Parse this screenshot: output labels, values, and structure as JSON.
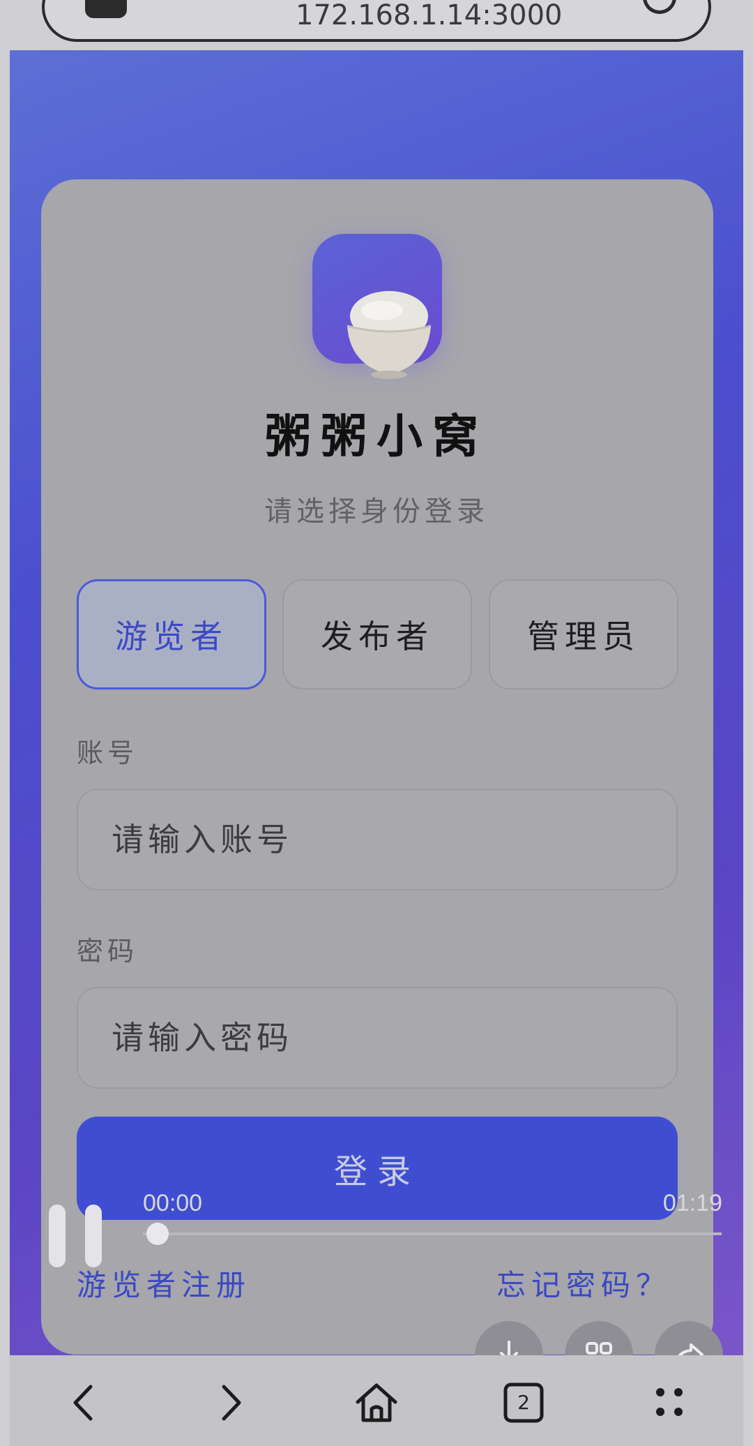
{
  "browser": {
    "address": "172.168.1.14:3000",
    "tab_count": "2",
    "icons": [
      "lock-icon",
      "refresh-icon",
      "back-icon",
      "forward-icon",
      "home-icon",
      "tabs-icon",
      "more-icon"
    ]
  },
  "app": {
    "title": "粥粥小窝",
    "subtitle": "请选择身份登录",
    "logo_icon": "rice-bowl-icon"
  },
  "roles": [
    {
      "label": "游览者",
      "selected": true
    },
    {
      "label": "发布者",
      "selected": false
    },
    {
      "label": "管理员",
      "selected": false
    }
  ],
  "form": {
    "account_label": "账号",
    "account_placeholder": "请输入账号",
    "password_label": "密码",
    "password_placeholder": "请输入密码",
    "login_label": "登录"
  },
  "links": {
    "register": "游览者注册",
    "forgot": "忘记密码？"
  },
  "video": {
    "current_time": "00:00",
    "total_time": "01:19",
    "progress": 0
  },
  "colors": {
    "accent": "#3f4ed0",
    "gradient_start": "#5d6fd6",
    "gradient_end": "#7a56c8",
    "selected_role_border": "#4a5ad8"
  }
}
